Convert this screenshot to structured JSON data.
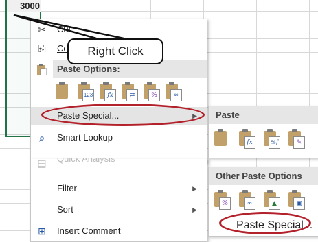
{
  "sheet": {
    "selected_cell_value": "3000"
  },
  "callout": {
    "text": "Right Click"
  },
  "context_menu": {
    "cut_label_partial": "Cut",
    "copy_label_partial": "Co",
    "paste_options_header": "Paste Options:",
    "paste_special_label": "Paste Special...",
    "smart_lookup_label": "Smart Lookup",
    "quick_analysis_label": "Quick Analysis",
    "filter_label": "Filter",
    "sort_label": "Sort",
    "insert_comment_label": "Insert Comment",
    "paste_option_icons": [
      {
        "icon": "paste-icon",
        "glyph": ""
      },
      {
        "icon": "paste-values-icon",
        "glyph": "123"
      },
      {
        "icon": "paste-formulas-icon",
        "glyph": "fx"
      },
      {
        "icon": "paste-transpose-icon",
        "glyph": "⇄"
      },
      {
        "icon": "paste-formatting-icon",
        "glyph": "%"
      },
      {
        "icon": "paste-link-icon",
        "glyph": "∞"
      }
    ]
  },
  "submenu_paste": {
    "header": "Paste",
    "icons": [
      "paste-icon",
      "paste-formulas-icon",
      "paste-formulas-number-formatting-icon",
      "paste-keep-source-formatting-icon"
    ]
  },
  "submenu_other": {
    "header": "Other Paste Options",
    "icons": [
      "paste-formatting-icon",
      "paste-link-icon",
      "paste-picture-icon",
      "paste-linked-picture-icon"
    ],
    "paste_special_label": "Paste Special..."
  },
  "colors": {
    "highlight_oval": "#b3212a",
    "selection_border": "#217346"
  }
}
